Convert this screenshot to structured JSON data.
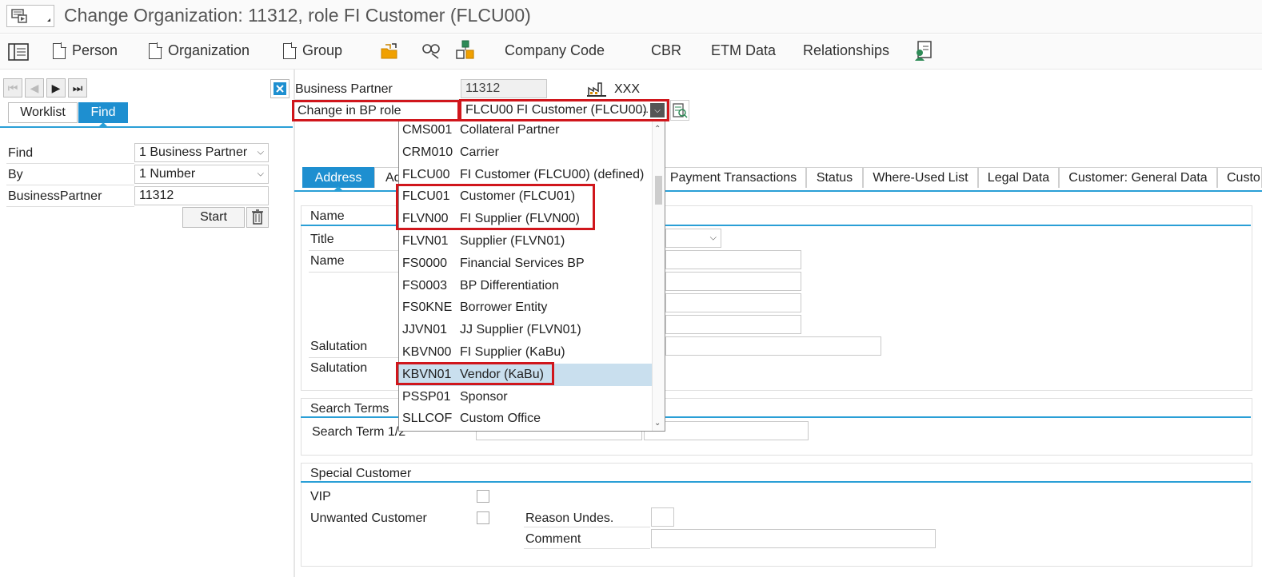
{
  "window": {
    "title": "Change Organization: 11312, role FI Customer (FLCU00)"
  },
  "toolbar": {
    "person": "Person",
    "organization": "Organization",
    "group": "Group",
    "company_code": "Company Code",
    "cbr": "CBR",
    "etm_data": "ETM Data",
    "relationships": "Relationships"
  },
  "left_panel": {
    "tabs": {
      "worklist": "Worklist",
      "find": "Find"
    },
    "find_label": "Find",
    "find_value": "1 Business Partner",
    "by_label": "By",
    "by_value": "1 Number",
    "bp_label": "BusinessPartner",
    "bp_value": "11312",
    "start_button": "Start"
  },
  "header": {
    "bp_label": "Business Partner",
    "bp_value": "11312",
    "bp_type_text": "XXX",
    "role_label": "Change in BP role",
    "role_value": "FLCU00 FI Customer (FLCU00)",
    "role_ellipsis": "..."
  },
  "tabs": {
    "address": "Address",
    "address_partial": "Ad",
    "payment_transactions": "Payment Transactions",
    "status": "Status",
    "where_used": "Where-Used List",
    "legal_data": "Legal Data",
    "customer_general": "Customer: General Data",
    "customer_partial": "Custo"
  },
  "form": {
    "name_section": "Name",
    "title_label": "Title",
    "name_label": "Name",
    "salutation_label_1": "Salutation",
    "salutation_label_2": "Salutation",
    "search_terms_section": "Search Terms",
    "search_term_label": "Search Term 1/2",
    "special_customer_section": "Special Customer",
    "vip_label": "VIP",
    "unwanted_label": "Unwanted Customer",
    "reason_label": "Reason Undes.",
    "comment_label": "Comment"
  },
  "dropdown": {
    "items": [
      {
        "code": "CMS001",
        "text": "Collateral Partner"
      },
      {
        "code": "CRM010",
        "text": "Carrier"
      },
      {
        "code": "FLCU00",
        "text": "FI Customer (FLCU00) (defined)"
      },
      {
        "code": "FLCU01",
        "text": "Customer (FLCU01)"
      },
      {
        "code": "FLVN00",
        "text": "FI Supplier (FLVN00)"
      },
      {
        "code": "FLVN01",
        "text": "Supplier (FLVN01)"
      },
      {
        "code": "FS0000",
        "text": "Financial Services BP"
      },
      {
        "code": "FS0003",
        "text": "BP Differentiation"
      },
      {
        "code": "FS0KNE",
        "text": "Borrower Entity"
      },
      {
        "code": "JJVN01",
        "text": "JJ Supplier (FLVN01)"
      },
      {
        "code": "KBVN00",
        "text": "FI Supplier (KaBu)"
      },
      {
        "code": "KBVN01",
        "text": "Vendor (KaBu)"
      },
      {
        "code": "PSSP01",
        "text": "Sponsor"
      },
      {
        "code": "SLLCOF",
        "text": "Custom Office"
      }
    ],
    "selected_code": "KBVN01"
  },
  "colors": {
    "accent": "#2a9fd6",
    "tab_active": "#1e8fd0",
    "highlight": "#d0161c",
    "selected_row": "#c9dfee"
  }
}
